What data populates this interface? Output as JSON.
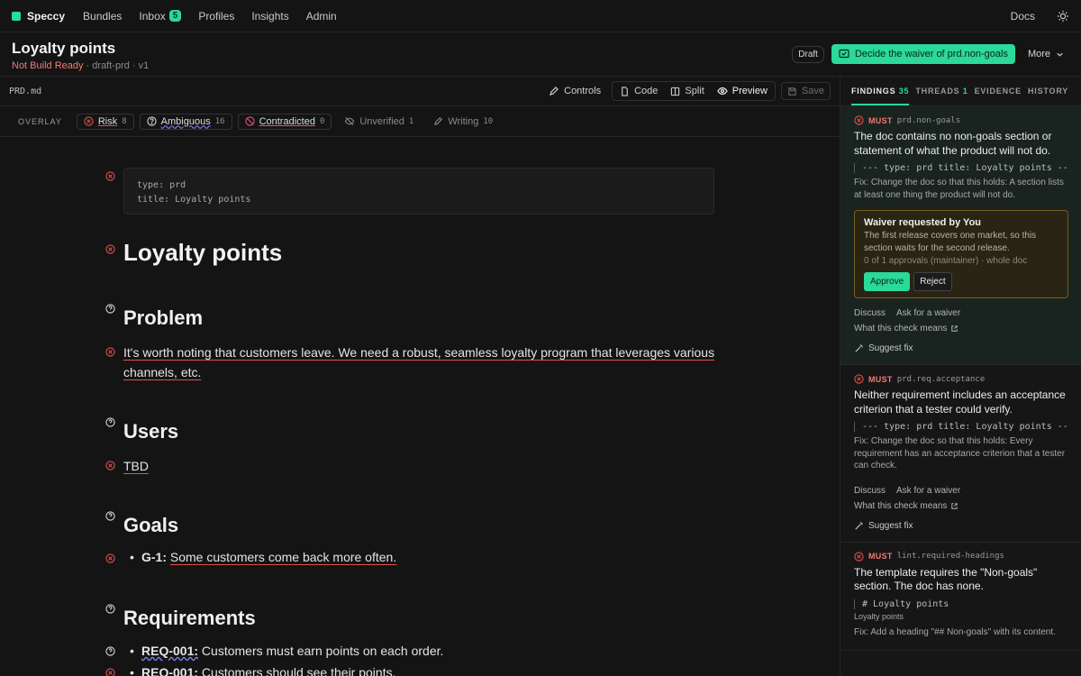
{
  "nav": {
    "brand": "Speccy",
    "items": [
      "Bundles",
      "Inbox",
      "Profiles",
      "Insights",
      "Admin"
    ],
    "inbox_count": "5",
    "docs": "Docs"
  },
  "header": {
    "title": "Loyalty points",
    "status": "Not Build Ready",
    "meta": "· draft-prd · v1",
    "draft": "Draft",
    "cta": "Decide the waiver of prd.non-goals",
    "more": "More"
  },
  "editor": {
    "filename": "PRD.md",
    "controls": "Controls",
    "code": "Code",
    "split": "Split",
    "preview": "Preview",
    "save": "Save"
  },
  "overlay": {
    "label": "OVERLAY",
    "chips": [
      {
        "label": "Risk",
        "count": "8"
      },
      {
        "label": "Ambiguous",
        "count": "16"
      },
      {
        "label": "Contradicted",
        "count": "0"
      },
      {
        "label": "Unverified",
        "count": "1"
      },
      {
        "label": "Writing",
        "count": "10"
      }
    ]
  },
  "doc": {
    "frontmatter": [
      "type: prd",
      "title: Loyalty points"
    ],
    "h1": "Loyalty points",
    "problem": "Problem",
    "problem_text": "It's worth noting that customers leave. We need a robust, seamless loyalty program that leverages various channels, etc.",
    "users": "Users",
    "users_text": "TBD",
    "goals": "Goals",
    "goal_id": "G-1:",
    "goal_text": "Some customers come back more often.",
    "requirements": "Requirements",
    "req1_id": "REQ-001:",
    "req1_text": "Customers must earn points on each order.",
    "req2_id": "REQ-001:",
    "req2_text": "Customers should see their points."
  },
  "panel": {
    "tabs": {
      "findings": "FINDINGS",
      "findings_count": "35",
      "threads": "THREADS",
      "threads_count": "1",
      "evidence": "EVIDENCE",
      "history": "HISTORY"
    },
    "findings": [
      {
        "level": "MUST",
        "rule": "prd.non-goals",
        "text": "The doc contains no non-goals section or statement of what the product will not do.",
        "quote": "--- type: prd title: Loyalty points ---",
        "fix": "Fix: Change the doc so that this holds: A section lists at least one thing the product will not do."
      },
      {
        "level": "MUST",
        "rule": "prd.req.acceptance",
        "text": "Neither requirement includes an acceptance criterion that a tester could verify.",
        "quote": "--- type: prd title: Loyalty points ---",
        "fix": "Fix: Change the doc so that this holds: Every requirement has an acceptance criterion that a tester can check."
      },
      {
        "level": "MUST",
        "rule": "lint.required-headings",
        "text": "The template requires the \"Non-goals\" section. The doc has none.",
        "quote": "# Loyalty points",
        "quote_sub": "Loyalty points",
        "fix": "Fix: Add a heading \"## Non-goals\" with its content."
      }
    ],
    "waiver": {
      "title": "Waiver requested by You",
      "body": "The first release covers one market, so this section waits for the second release.",
      "meta": "0 of 1 approvals (maintainer) · whole doc",
      "approve": "Approve",
      "reject": "Reject"
    },
    "links": {
      "discuss": "Discuss",
      "ask": "Ask for a waiver",
      "means": "What this check means",
      "suggest": "Suggest fix"
    }
  }
}
